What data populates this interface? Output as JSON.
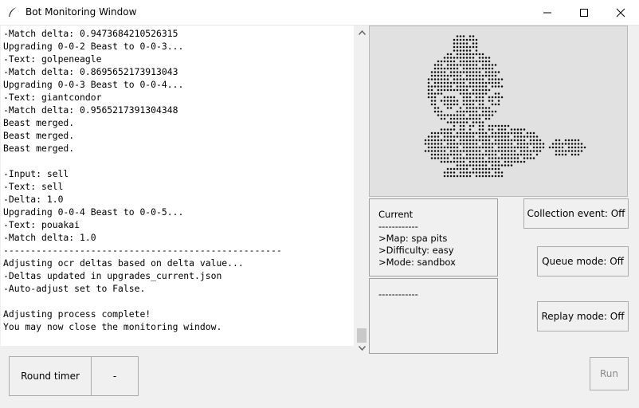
{
  "window": {
    "title": "Bot Monitoring Window"
  },
  "console": {
    "lines": [
      "-Match delta: 0.9473684210526315",
      "Upgrading 0-0-2 Beast to 0-0-3...",
      "-Text: golpeneagle",
      "-Match delta: 0.8695652173913043",
      "Upgrading 0-0-3 Beast to 0-0-4...",
      "-Text: giantcondor",
      "-Match delta: 0.9565217391304348",
      "Beast merged.",
      "Beast merged.",
      "Beast merged.",
      "",
      "-Input: sell",
      "-Text: sell",
      "-Delta: 1.0",
      "Upgrading 0-0-4 Beast to 0-0-5...",
      "-Text: pouakai",
      "-Match delta: 1.0",
      "---------------------------------------------------",
      "Adjusting ocr deltas based on delta value...",
      "-Deltas updated in upgrades_current.json",
      "-Auto-adjust set to False.",
      "",
      "Adjusting process complete!",
      "You may now close the monitoring window."
    ]
  },
  "status": {
    "heading": "Current",
    "divider": "------------",
    "map": ">Map: spa pits",
    "difficulty": ">Difficulty: easy",
    "mode": ">Mode: sandbox"
  },
  "events": {
    "divider": "------------"
  },
  "buttons": {
    "collection_event": "Collection event: Off",
    "queue_mode": "Queue mode: Off",
    "replay_mode": "Replay mode: Off",
    "round_timer": "Round timer",
    "round_timer_value": "-",
    "run": "Run"
  },
  "icons": {
    "title": "feather-icon",
    "minimize": "minimize-icon",
    "maximize": "maximize-icon",
    "close": "close-icon",
    "scroll_up": "scroll-up-icon",
    "scroll_down": "scroll-down-icon",
    "logo": "monkey-logo-icon"
  },
  "colors": {
    "disabled_text": "#8a8a8a",
    "logo_panel": "#e1e1e1"
  }
}
